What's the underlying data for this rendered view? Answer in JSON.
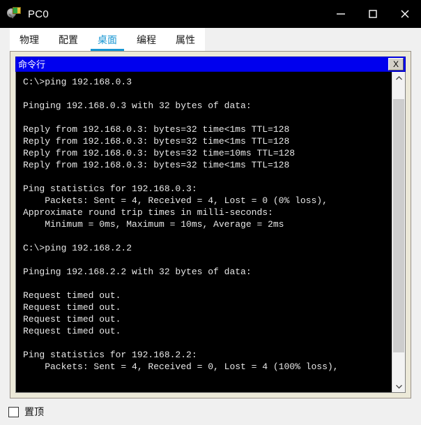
{
  "window": {
    "title": "PC0",
    "icon": "packet-tracer-pc-icon",
    "controls": {
      "minimize": "minimize-icon",
      "maximize": "maximize-icon",
      "close": "close-icon"
    }
  },
  "tabs": [
    {
      "label": "物理",
      "active": false
    },
    {
      "label": "配置",
      "active": false
    },
    {
      "label": "桌面",
      "active": true
    },
    {
      "label": "编程",
      "active": false
    },
    {
      "label": "属性",
      "active": false
    }
  ],
  "command_prompt": {
    "title": "命令行",
    "close_label": "X",
    "lines": [
      "C:\\>ping 192.168.0.3",
      "",
      "Pinging 192.168.0.3 with 32 bytes of data:",
      "",
      "Reply from 192.168.0.3: bytes=32 time<1ms TTL=128",
      "Reply from 192.168.0.3: bytes=32 time<1ms TTL=128",
      "Reply from 192.168.0.3: bytes=32 time=10ms TTL=128",
      "Reply from 192.168.0.3: bytes=32 time<1ms TTL=128",
      "",
      "Ping statistics for 192.168.0.3:",
      "    Packets: Sent = 4, Received = 4, Lost = 0 (0% loss),",
      "Approximate round trip times in milli-seconds:",
      "    Minimum = 0ms, Maximum = 10ms, Average = 2ms",
      "",
      "C:\\>ping 192.168.2.2",
      "",
      "Pinging 192.168.2.2 with 32 bytes of data:",
      "",
      "Request timed out.",
      "Request timed out.",
      "Request timed out.",
      "Request timed out.",
      "",
      "Ping statistics for 192.168.2.2:",
      "    Packets: Sent = 4, Received = 0, Lost = 4 (100% loss),"
    ]
  },
  "scrollbar": {
    "up_arrow": "chevron-up-icon",
    "down_arrow": "chevron-down-icon"
  },
  "footer": {
    "checkbox_label": "置顶",
    "checked": false
  },
  "colors": {
    "titlebar_bg": "#000000",
    "accent_tab": "#1796d3",
    "panel_bg": "#ece9d8",
    "cmd_titlebar_bg": "#0000ee",
    "console_bg": "#000000",
    "console_fg": "#e8e8e8",
    "window_bg": "#f0f0f0"
  }
}
